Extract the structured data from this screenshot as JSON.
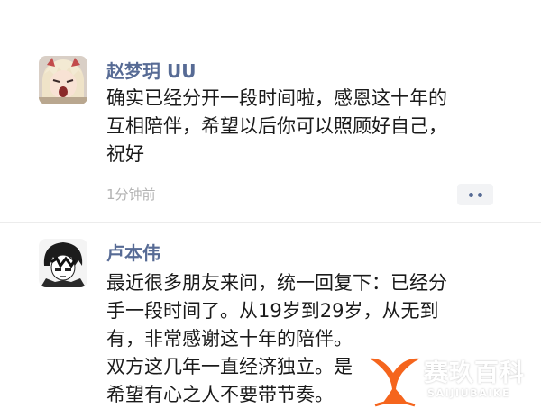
{
  "posts": [
    {
      "username": "赵梦玥 UU",
      "content_lines": [
        "确实已经分开一段时间啦，感恩这十年的",
        "互相陪伴，希望以后你可以照顾好自己，",
        "祝好"
      ],
      "timestamp": "1分钟前",
      "more_icon": "more-dots-icon"
    },
    {
      "username": "卢本伟",
      "content_lines": [
        "最近很多朋友来问，统一回复下：已经分",
        "手一段时间了。从19岁到29岁，从无到",
        "有，非常感谢这十年的陪伴。",
        "双方这几年一直经济独立。是",
        "希望有心之人不要带节奏。"
      ]
    }
  ],
  "watermark": {
    "title": "赛玖百科",
    "subtitle": "SAIJIUBAIKE",
    "icon": "whale-tail-icon",
    "color": "#f5651d"
  },
  "colors": {
    "username": "#576b95",
    "text": "#1a1a1a",
    "timestamp": "#b2b2b2",
    "divider": "#ececec"
  }
}
